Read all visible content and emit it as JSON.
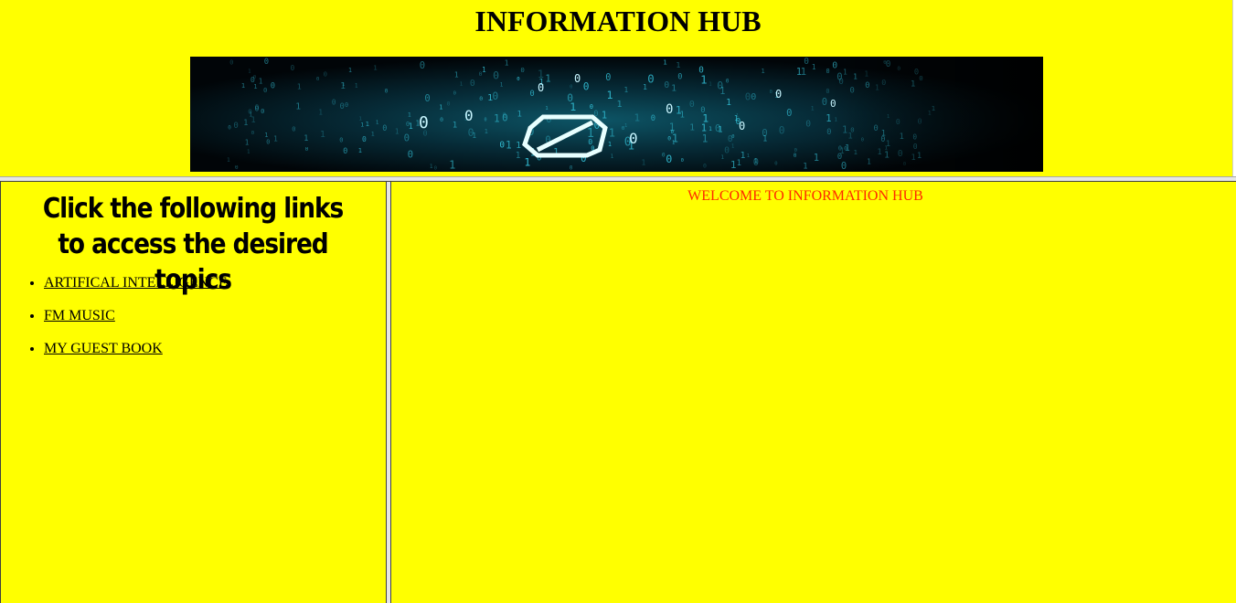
{
  "header": {
    "title": "INFORMATION HUB",
    "banner_image": "binary-code-digital-banner"
  },
  "sidebar": {
    "heading": "Click the following links to access the desired topics",
    "links": [
      {
        "label": "ARTIFICAL INTELLIGENCE"
      },
      {
        "label": "FM MUSIC"
      },
      {
        "label": "MY GUEST BOOK"
      }
    ]
  },
  "main": {
    "welcome_text": "WELCOME TO INFORMATION HUB"
  },
  "colors": {
    "background": "#ffff00",
    "welcome_text": "#ff2a00",
    "link": "#000000",
    "banner_glow": "#38d8f0"
  }
}
